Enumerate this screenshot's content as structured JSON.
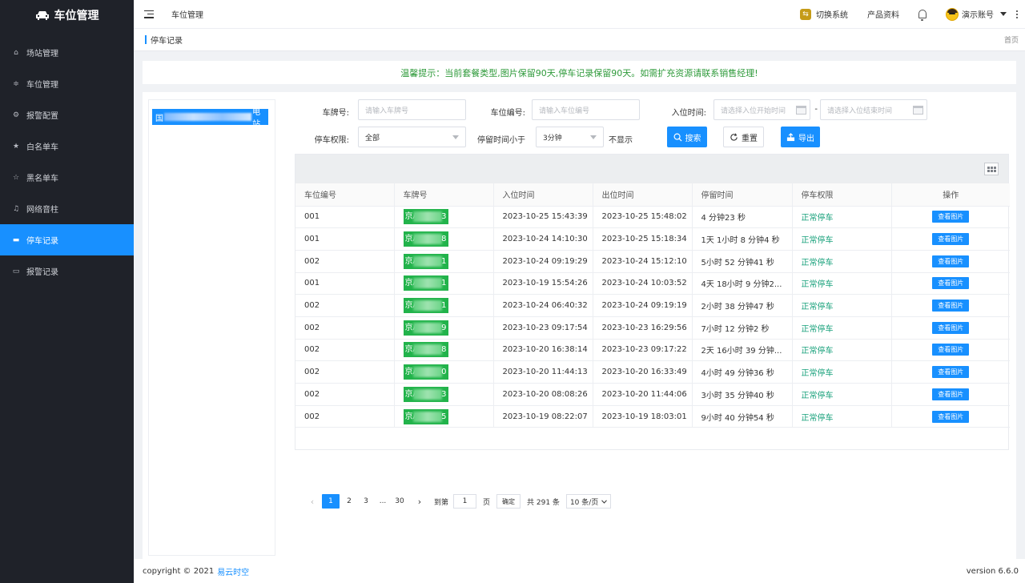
{
  "app": {
    "logo_text": "车位管理"
  },
  "sidebar": {
    "items": [
      {
        "label": "场站管理",
        "icon": "home-icon"
      },
      {
        "label": "车位管理",
        "icon": "sliders-icon"
      },
      {
        "label": "报警配置",
        "icon": "gear-icon"
      },
      {
        "label": "白名单车",
        "icon": "star-filled-icon"
      },
      {
        "label": "黑名单车",
        "icon": "star-outline-icon"
      },
      {
        "label": "网络音柱",
        "icon": "bell-icon"
      },
      {
        "label": "停车记录",
        "icon": "message-icon",
        "active": true
      },
      {
        "label": "报警记录",
        "icon": "monitor-icon"
      }
    ]
  },
  "header": {
    "title": "车位管理",
    "switch_system": "切换系统",
    "product_docs": "产品资料",
    "account": "演示账号"
  },
  "breadcrumb": {
    "current": "停车记录",
    "home": "首页"
  },
  "notice": "温馨提示：当前套餐类型,图片保留90天,停车记录保留90天。如需扩充资源请联系销售经理!",
  "tree": {
    "node_prefix": "国",
    "node_suffix": "电站"
  },
  "filters": {
    "plate_label": "车牌号:",
    "plate_placeholder": "请输入车牌号",
    "space_label": "车位编号:",
    "space_placeholder": "请输入车位编号",
    "entry_label": "入位时间:",
    "entry_start_placeholder": "请选择入位开始时间",
    "entry_sep": "-",
    "entry_end_placeholder": "请选择入位结束时间",
    "perm_label": "停车权限:",
    "perm_value": "全部",
    "stay_label": "停留时间小于",
    "stay_value": "3分钟",
    "stay_suffix": "不显示",
    "search_btn": "搜索",
    "reset_btn": "重置",
    "export_btn": "导出"
  },
  "table": {
    "columns": [
      "车位编号",
      "车牌号",
      "入位时间",
      "出位时间",
      "停留时间",
      "停车权限",
      "操作"
    ],
    "rows": [
      {
        "space": "001",
        "plate_prefix": "京A",
        "plate_last": "3",
        "in": "2023-10-25 15:43:39",
        "out": "2023-10-25 15:48:02",
        "stay": "4 分钟23 秒",
        "perm": "正常停车",
        "action": "查看图片"
      },
      {
        "space": "001",
        "plate_prefix": "京A",
        "plate_last": "8",
        "in": "2023-10-24 14:10:30",
        "out": "2023-10-25 15:18:34",
        "stay": "1天 1小时 8 分钟4 秒",
        "perm": "正常停车",
        "action": "查看图片"
      },
      {
        "space": "002",
        "plate_prefix": "京A",
        "plate_last": "1",
        "in": "2023-10-24 09:19:29",
        "out": "2023-10-24 15:12:10",
        "stay": "5小时 52 分钟41 秒",
        "perm": "正常停车",
        "action": "查看图片"
      },
      {
        "space": "001",
        "plate_prefix": "京A",
        "plate_last": "1",
        "in": "2023-10-19 15:54:26",
        "out": "2023-10-24 10:03:52",
        "stay": "4天 18小时 9 分钟2...",
        "perm": "正常停车",
        "action": "查看图片"
      },
      {
        "space": "002",
        "plate_prefix": "京A",
        "plate_last": "1",
        "in": "2023-10-24 06:40:32",
        "out": "2023-10-24 09:19:19",
        "stay": "2小时 38 分钟47 秒",
        "perm": "正常停车",
        "action": "查看图片"
      },
      {
        "space": "002",
        "plate_prefix": "京A",
        "plate_last": "9",
        "in": "2023-10-23 09:17:54",
        "out": "2023-10-23 16:29:56",
        "stay": "7小时 12 分钟2 秒",
        "perm": "正常停车",
        "action": "查看图片"
      },
      {
        "space": "002",
        "plate_prefix": "京A",
        "plate_last": "8",
        "in": "2023-10-20 16:38:14",
        "out": "2023-10-23 09:17:22",
        "stay": "2天 16小时 39 分钟...",
        "perm": "正常停车",
        "action": "查看图片"
      },
      {
        "space": "002",
        "plate_prefix": "京A",
        "plate_last": "0",
        "in": "2023-10-20 11:44:13",
        "out": "2023-10-20 16:33:49",
        "stay": "4小时 49 分钟36 秒",
        "perm": "正常停车",
        "action": "查看图片"
      },
      {
        "space": "002",
        "plate_prefix": "京A",
        "plate_last": "3",
        "in": "2023-10-20 08:08:26",
        "out": "2023-10-20 11:44:06",
        "stay": "3小时 35 分钟40 秒",
        "perm": "正常停车",
        "action": "查看图片"
      },
      {
        "space": "002",
        "plate_prefix": "京A",
        "plate_last": "5",
        "in": "2023-10-19 08:22:07",
        "out": "2023-10-19 18:03:01",
        "stay": "9小时 40 分钟54 秒",
        "perm": "正常停车",
        "action": "查看图片"
      }
    ]
  },
  "pagination": {
    "pages": [
      "1",
      "2",
      "3",
      "...",
      "30"
    ],
    "current": "1",
    "goto_label": "到第",
    "goto_value": "1",
    "page_unit": "页",
    "confirm": "确定",
    "total": "共 291 条",
    "page_size": "10 条/页"
  },
  "footer": {
    "copyright": "copyright © 2021",
    "brand": "易云时空",
    "version": "version 6.6.0"
  },
  "colors": {
    "primary": "#1890ff",
    "sidebar_bg": "#1f2229",
    "plate_green": "#22b34b",
    "notice_green": "#2e9a3a"
  }
}
